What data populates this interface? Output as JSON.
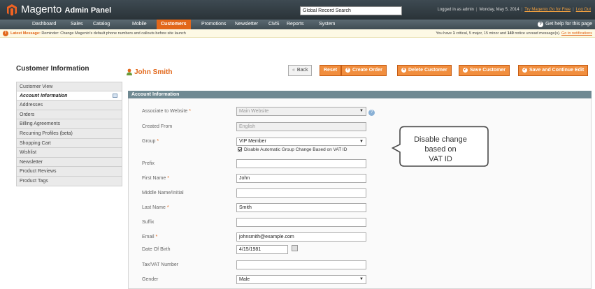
{
  "header": {
    "logo": "Magento",
    "logo_sub": "Admin Panel",
    "search_value": "Global Record Search",
    "logged_in": "Logged in as admin",
    "date": "Monday, May 5, 2014",
    "link_go": "Try Magento Go for Free",
    "link_logout": "Log Out"
  },
  "nav": {
    "items": [
      "Dashboard",
      "Sales",
      "Catalog",
      "Mobile",
      "Customers",
      "Promotions",
      "Newsletter",
      "CMS",
      "Reports",
      "System"
    ],
    "active": "Customers",
    "help": "Get help for this page"
  },
  "message": {
    "label": "Latest Message:",
    "text": "Reminder: Change Magento's default phone numbers and callouts before site launch",
    "right_prefix": "You have",
    "critical_count": "1",
    "right_mid": "critical, 5 major, 15 minor and",
    "notice_count": "140",
    "right_suffix": "notice unread message(s).",
    "link": "Go to notifications"
  },
  "sidebar": {
    "title": "Customer Information",
    "items": [
      "Customer View",
      "Account Information",
      "Addresses",
      "Orders",
      "Billing Agreements",
      "Recurring Profiles (beta)",
      "Shopping Cart",
      "Wishlist",
      "Newsletter",
      "Product Reviews",
      "Product Tags"
    ],
    "active_index": 1
  },
  "page": {
    "title": "John Smith",
    "buttons": {
      "back": "Back",
      "reset": "Reset",
      "create_order": "Create Order",
      "delete": "Delete Customer",
      "save": "Save Customer",
      "save_continue": "Save and Continue Edit"
    }
  },
  "account": {
    "section_title": "Account Information",
    "labels": {
      "website": "Associate to Website",
      "created_from": "Created From",
      "group": "Group",
      "prefix": "Prefix",
      "first_name": "First Name",
      "middle_name": "Middle Name/Initial",
      "last_name": "Last Name",
      "suffix": "Suffix",
      "email": "Email",
      "dob": "Date Of Birth",
      "taxvat": "Tax/VAT Number",
      "gender": "Gender"
    },
    "values": {
      "website": "Main Website",
      "created_from": "English",
      "group": "VIP Member",
      "disable_group_change": "Disable Automatic Group Change Based on VAT ID",
      "prefix": "",
      "first_name": "John",
      "middle_name": "",
      "last_name": "Smith",
      "suffix": "",
      "email": "johnsmith@example.com",
      "dob": "4/15/1981",
      "taxvat": "",
      "gender": "Male"
    },
    "required_mark": "*"
  },
  "callout": {
    "line1": "Disable change",
    "line2": "based on",
    "line3": "VAT ID"
  },
  "colors": {
    "accent": "#e2671a",
    "header_bg": "#2f393e",
    "section_head": "#6f8992"
  }
}
